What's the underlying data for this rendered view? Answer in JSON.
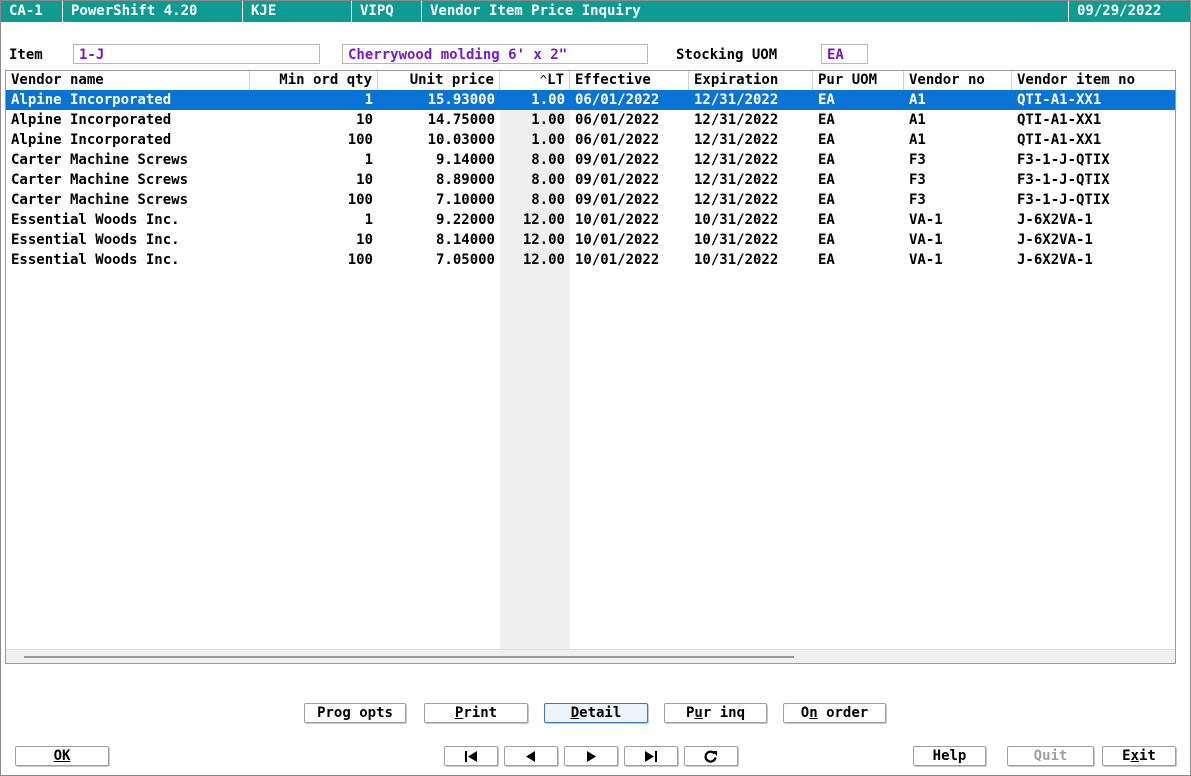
{
  "titlebar": {
    "screen_id": "CA-1",
    "app": "PowerShift 4.20",
    "user": "KJE",
    "program": "VIPQ",
    "title": "Vendor Item Price Inquiry",
    "date": "09/29/2022"
  },
  "form": {
    "item_label": "Item",
    "item_value": "1-J",
    "description_value": "Cherrywood molding 6' x 2\"",
    "stocking_uom_label": "Stocking UOM",
    "stocking_uom_value": "EA"
  },
  "grid": {
    "columns": [
      "Vendor name",
      "Min ord qty",
      "Unit price",
      "LT",
      "Effective",
      "Expiration",
      "Pur UOM",
      "Vendor no",
      "Vendor item no"
    ],
    "sort_indicator": "^",
    "rows": [
      {
        "vendor_name": "Alpine Incorporated",
        "min_ord_qty": "1",
        "unit_price": "15.93000",
        "lt": "1.00",
        "effective": "06/01/2022",
        "expiration": "12/31/2022",
        "pur_uom": "EA",
        "vendor_no": "A1",
        "vendor_item_no": "QTI-A1-XX1",
        "selected": true
      },
      {
        "vendor_name": "Alpine Incorporated",
        "min_ord_qty": "10",
        "unit_price": "14.75000",
        "lt": "1.00",
        "effective": "06/01/2022",
        "expiration": "12/31/2022",
        "pur_uom": "EA",
        "vendor_no": "A1",
        "vendor_item_no": "QTI-A1-XX1",
        "selected": false
      },
      {
        "vendor_name": "Alpine Incorporated",
        "min_ord_qty": "100",
        "unit_price": "10.03000",
        "lt": "1.00",
        "effective": "06/01/2022",
        "expiration": "12/31/2022",
        "pur_uom": "EA",
        "vendor_no": "A1",
        "vendor_item_no": "QTI-A1-XX1",
        "selected": false
      },
      {
        "vendor_name": "Carter Machine Screws",
        "min_ord_qty": "1",
        "unit_price": "9.14000",
        "lt": "8.00",
        "effective": "09/01/2022",
        "expiration": "12/31/2022",
        "pur_uom": "EA",
        "vendor_no": "F3",
        "vendor_item_no": "F3-1-J-QTIX",
        "selected": false
      },
      {
        "vendor_name": "Carter Machine Screws",
        "min_ord_qty": "10",
        "unit_price": "8.89000",
        "lt": "8.00",
        "effective": "09/01/2022",
        "expiration": "12/31/2022",
        "pur_uom": "EA",
        "vendor_no": "F3",
        "vendor_item_no": "F3-1-J-QTIX",
        "selected": false
      },
      {
        "vendor_name": "Carter Machine Screws",
        "min_ord_qty": "100",
        "unit_price": "7.10000",
        "lt": "8.00",
        "effective": "09/01/2022",
        "expiration": "12/31/2022",
        "pur_uom": "EA",
        "vendor_no": "F3",
        "vendor_item_no": "F3-1-J-QTIX",
        "selected": false
      },
      {
        "vendor_name": "Essential Woods Inc.",
        "min_ord_qty": "1",
        "unit_price": "9.22000",
        "lt": "12.00",
        "effective": "10/01/2022",
        "expiration": "10/31/2022",
        "pur_uom": "EA",
        "vendor_no": "VA-1",
        "vendor_item_no": "J-6X2VA-1",
        "selected": false
      },
      {
        "vendor_name": "Essential Woods Inc.",
        "min_ord_qty": "10",
        "unit_price": "8.14000",
        "lt": "12.00",
        "effective": "10/01/2022",
        "expiration": "10/31/2022",
        "pur_uom": "EA",
        "vendor_no": "VA-1",
        "vendor_item_no": "J-6X2VA-1",
        "selected": false
      },
      {
        "vendor_name": "Essential Woods Inc.",
        "min_ord_qty": "100",
        "unit_price": "7.05000",
        "lt": "12.00",
        "effective": "10/01/2022",
        "expiration": "10/31/2022",
        "pur_uom": "EA",
        "vendor_no": "VA-1",
        "vendor_item_no": "J-6X2VA-1",
        "selected": false
      }
    ]
  },
  "actions": {
    "prog_opts": "Prog opts",
    "print_u": "P",
    "print_rest": "rint",
    "detail_u": "D",
    "detail_rest": "etail",
    "pur_inq_a": "P",
    "pur_inq_u": "u",
    "pur_inq_rest": "r inq",
    "on_order_a": "O",
    "on_order_u": "n",
    "on_order_rest": " order"
  },
  "footer": {
    "ok": "OK",
    "first_icon": "first-record-icon",
    "prev_icon": "previous-record-icon",
    "next_icon": "next-record-icon",
    "last_icon": "last-record-icon",
    "refresh_icon": "refresh-icon",
    "help": "Help",
    "quit": "Quit",
    "exit_a": "E",
    "exit_u": "x",
    "exit_rest": "it"
  },
  "colors": {
    "titlebar_bg": "#0e9c92",
    "selection_bg": "#0a73d6",
    "field_text": "#7a18c8"
  }
}
